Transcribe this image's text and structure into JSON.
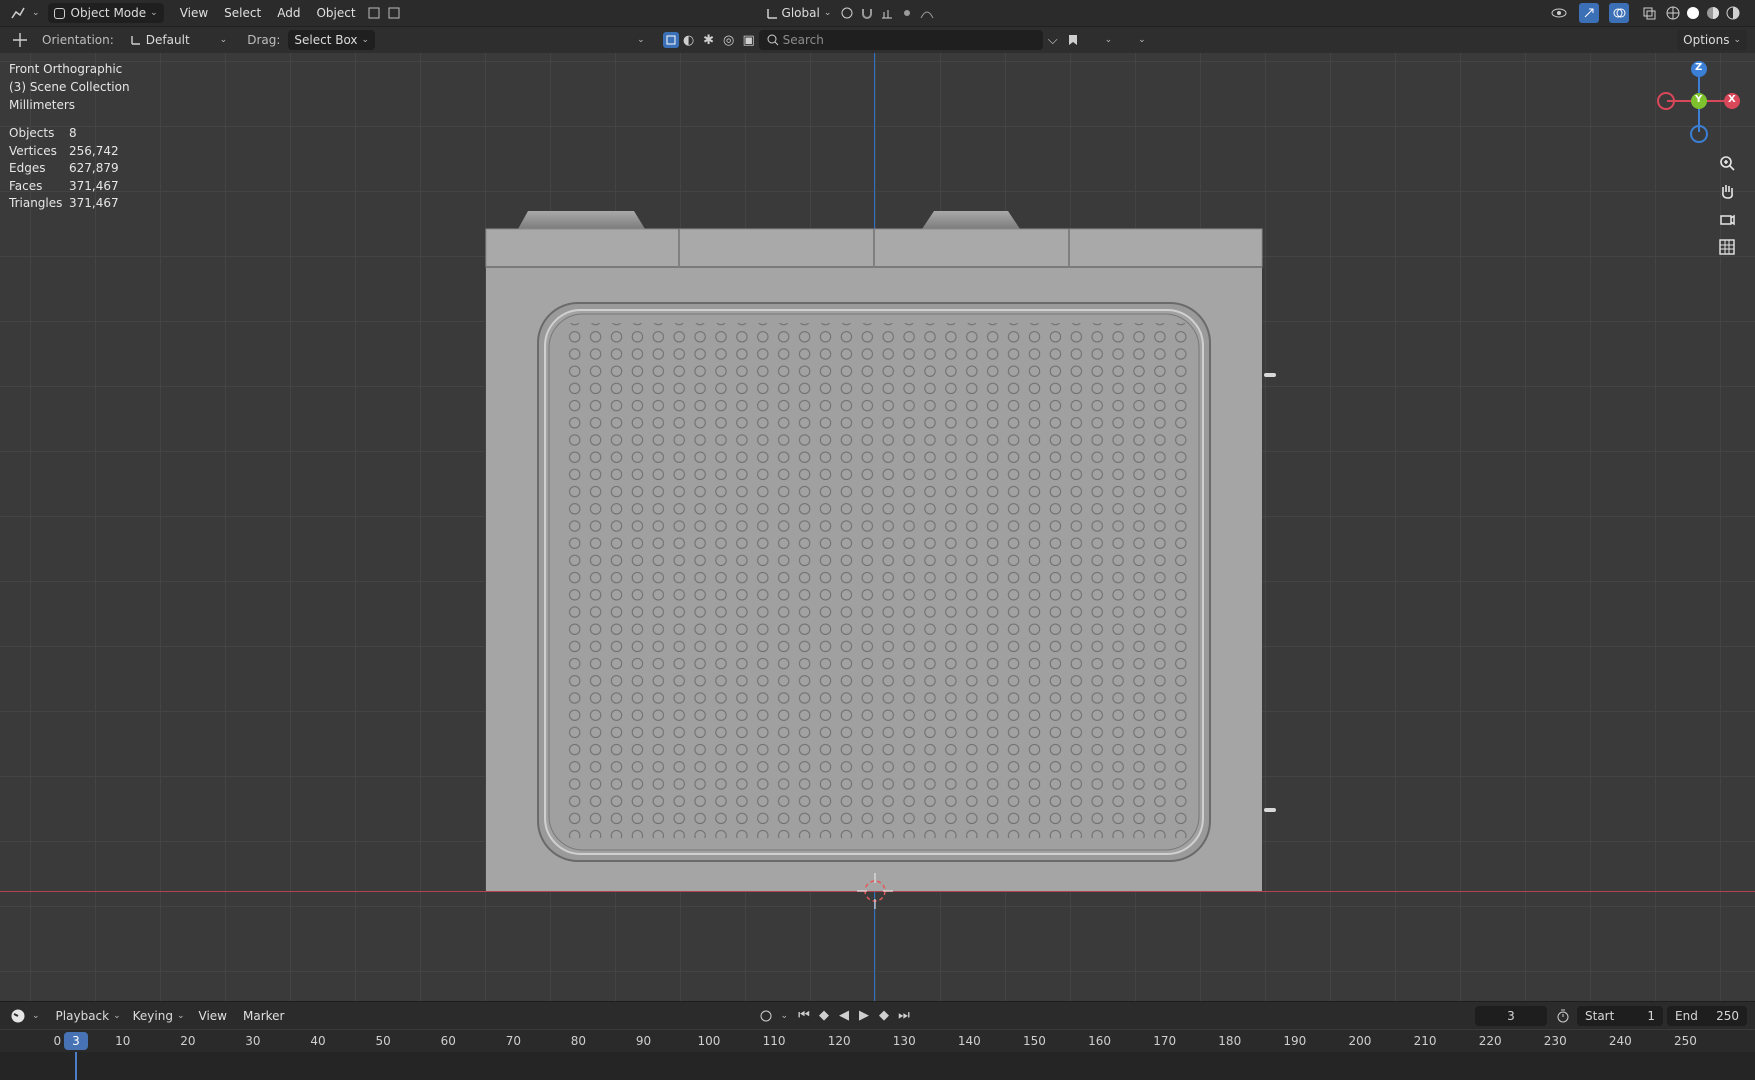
{
  "header": {
    "editor_type_icon": "3d-viewport-icon",
    "mode": "Object Mode",
    "menus": [
      "View",
      "Select",
      "Add",
      "Object"
    ],
    "transform_orientation": "Global"
  },
  "tool_settings": {
    "orientation_label": "Orientation:",
    "orientation_value": "Default",
    "drag_label": "Drag:",
    "drag_value": "Select Box",
    "search_placeholder": "Search",
    "options_label": "Options"
  },
  "viewport": {
    "view_name": "Front Orthographic",
    "collection": "(3) Scene Collection",
    "units": "Millimeters",
    "stats": [
      {
        "label": "Objects",
        "value": "8"
      },
      {
        "label": "Vertices",
        "value": "256,742"
      },
      {
        "label": "Edges",
        "value": "627,879"
      },
      {
        "label": "Faces",
        "value": "371,467"
      },
      {
        "label": "Triangles",
        "value": "371,467"
      }
    ],
    "gizmo": {
      "z": "Z",
      "y": "Y",
      "x": "X"
    },
    "colors": {
      "x_axis": "#d9475a",
      "y_axis": "#7ec32d",
      "z_axis": "#3b7fd6",
      "grid": "#444444",
      "background": "#3a3a3a"
    }
  },
  "timeline": {
    "menus": [
      "Playback",
      "Keying",
      "View",
      "Marker"
    ],
    "current_frame": "3",
    "start_label": "Start",
    "start_value": "1",
    "end_label": "End",
    "end_value": "250",
    "ticks": [
      "0",
      "10",
      "20",
      "30",
      "40",
      "50",
      "60",
      "70",
      "80",
      "90",
      "100",
      "110",
      "120",
      "130",
      "140",
      "150",
      "160",
      "170",
      "180",
      "190",
      "200",
      "210",
      "220",
      "230",
      "240",
      "250"
    ],
    "playhead_label": "3"
  }
}
